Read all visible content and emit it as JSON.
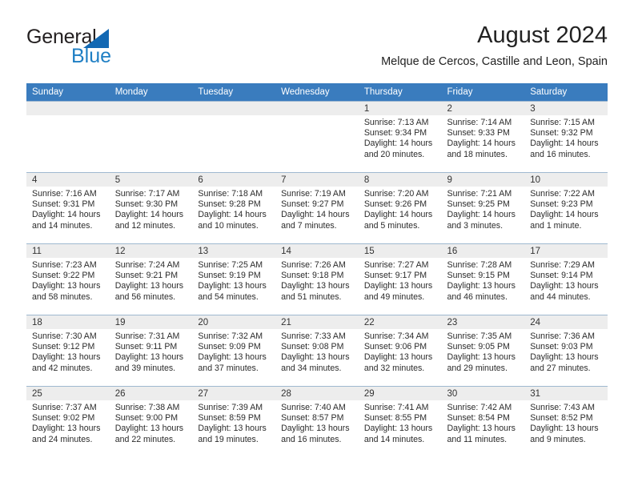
{
  "brand": {
    "word_one": "General",
    "word_two": "Blue",
    "triangle_icon": "triangle-logo-icon",
    "blue": "#1f7fc4"
  },
  "header": {
    "title": "August 2024",
    "subtitle": "Melque de Cercos, Castille and Leon, Spain"
  },
  "calendar": {
    "header_bg": "#3a7cbe",
    "daynum_bg": "#ededed",
    "weekdays": [
      "Sunday",
      "Monday",
      "Tuesday",
      "Wednesday",
      "Thursday",
      "Friday",
      "Saturday"
    ],
    "weeks": [
      [
        {
          "day": "",
          "lines": []
        },
        {
          "day": "",
          "lines": []
        },
        {
          "day": "",
          "lines": []
        },
        {
          "day": "",
          "lines": []
        },
        {
          "day": "1",
          "lines": [
            "Sunrise: 7:13 AM",
            "Sunset: 9:34 PM",
            "Daylight: 14 hours",
            "and 20 minutes."
          ]
        },
        {
          "day": "2",
          "lines": [
            "Sunrise: 7:14 AM",
            "Sunset: 9:33 PM",
            "Daylight: 14 hours",
            "and 18 minutes."
          ]
        },
        {
          "day": "3",
          "lines": [
            "Sunrise: 7:15 AM",
            "Sunset: 9:32 PM",
            "Daylight: 14 hours",
            "and 16 minutes."
          ]
        }
      ],
      [
        {
          "day": "4",
          "lines": [
            "Sunrise: 7:16 AM",
            "Sunset: 9:31 PM",
            "Daylight: 14 hours",
            "and 14 minutes."
          ]
        },
        {
          "day": "5",
          "lines": [
            "Sunrise: 7:17 AM",
            "Sunset: 9:30 PM",
            "Daylight: 14 hours",
            "and 12 minutes."
          ]
        },
        {
          "day": "6",
          "lines": [
            "Sunrise: 7:18 AM",
            "Sunset: 9:28 PM",
            "Daylight: 14 hours",
            "and 10 minutes."
          ]
        },
        {
          "day": "7",
          "lines": [
            "Sunrise: 7:19 AM",
            "Sunset: 9:27 PM",
            "Daylight: 14 hours",
            "and 7 minutes."
          ]
        },
        {
          "day": "8",
          "lines": [
            "Sunrise: 7:20 AM",
            "Sunset: 9:26 PM",
            "Daylight: 14 hours",
            "and 5 minutes."
          ]
        },
        {
          "day": "9",
          "lines": [
            "Sunrise: 7:21 AM",
            "Sunset: 9:25 PM",
            "Daylight: 14 hours",
            "and 3 minutes."
          ]
        },
        {
          "day": "10",
          "lines": [
            "Sunrise: 7:22 AM",
            "Sunset: 9:23 PM",
            "Daylight: 14 hours",
            "and 1 minute."
          ]
        }
      ],
      [
        {
          "day": "11",
          "lines": [
            "Sunrise: 7:23 AM",
            "Sunset: 9:22 PM",
            "Daylight: 13 hours",
            "and 58 minutes."
          ]
        },
        {
          "day": "12",
          "lines": [
            "Sunrise: 7:24 AM",
            "Sunset: 9:21 PM",
            "Daylight: 13 hours",
            "and 56 minutes."
          ]
        },
        {
          "day": "13",
          "lines": [
            "Sunrise: 7:25 AM",
            "Sunset: 9:19 PM",
            "Daylight: 13 hours",
            "and 54 minutes."
          ]
        },
        {
          "day": "14",
          "lines": [
            "Sunrise: 7:26 AM",
            "Sunset: 9:18 PM",
            "Daylight: 13 hours",
            "and 51 minutes."
          ]
        },
        {
          "day": "15",
          "lines": [
            "Sunrise: 7:27 AM",
            "Sunset: 9:17 PM",
            "Daylight: 13 hours",
            "and 49 minutes."
          ]
        },
        {
          "day": "16",
          "lines": [
            "Sunrise: 7:28 AM",
            "Sunset: 9:15 PM",
            "Daylight: 13 hours",
            "and 46 minutes."
          ]
        },
        {
          "day": "17",
          "lines": [
            "Sunrise: 7:29 AM",
            "Sunset: 9:14 PM",
            "Daylight: 13 hours",
            "and 44 minutes."
          ]
        }
      ],
      [
        {
          "day": "18",
          "lines": [
            "Sunrise: 7:30 AM",
            "Sunset: 9:12 PM",
            "Daylight: 13 hours",
            "and 42 minutes."
          ]
        },
        {
          "day": "19",
          "lines": [
            "Sunrise: 7:31 AM",
            "Sunset: 9:11 PM",
            "Daylight: 13 hours",
            "and 39 minutes."
          ]
        },
        {
          "day": "20",
          "lines": [
            "Sunrise: 7:32 AM",
            "Sunset: 9:09 PM",
            "Daylight: 13 hours",
            "and 37 minutes."
          ]
        },
        {
          "day": "21",
          "lines": [
            "Sunrise: 7:33 AM",
            "Sunset: 9:08 PM",
            "Daylight: 13 hours",
            "and 34 minutes."
          ]
        },
        {
          "day": "22",
          "lines": [
            "Sunrise: 7:34 AM",
            "Sunset: 9:06 PM",
            "Daylight: 13 hours",
            "and 32 minutes."
          ]
        },
        {
          "day": "23",
          "lines": [
            "Sunrise: 7:35 AM",
            "Sunset: 9:05 PM",
            "Daylight: 13 hours",
            "and 29 minutes."
          ]
        },
        {
          "day": "24",
          "lines": [
            "Sunrise: 7:36 AM",
            "Sunset: 9:03 PM",
            "Daylight: 13 hours",
            "and 27 minutes."
          ]
        }
      ],
      [
        {
          "day": "25",
          "lines": [
            "Sunrise: 7:37 AM",
            "Sunset: 9:02 PM",
            "Daylight: 13 hours",
            "and 24 minutes."
          ]
        },
        {
          "day": "26",
          "lines": [
            "Sunrise: 7:38 AM",
            "Sunset: 9:00 PM",
            "Daylight: 13 hours",
            "and 22 minutes."
          ]
        },
        {
          "day": "27",
          "lines": [
            "Sunrise: 7:39 AM",
            "Sunset: 8:59 PM",
            "Daylight: 13 hours",
            "and 19 minutes."
          ]
        },
        {
          "day": "28",
          "lines": [
            "Sunrise: 7:40 AM",
            "Sunset: 8:57 PM",
            "Daylight: 13 hours",
            "and 16 minutes."
          ]
        },
        {
          "day": "29",
          "lines": [
            "Sunrise: 7:41 AM",
            "Sunset: 8:55 PM",
            "Daylight: 13 hours",
            "and 14 minutes."
          ]
        },
        {
          "day": "30",
          "lines": [
            "Sunrise: 7:42 AM",
            "Sunset: 8:54 PM",
            "Daylight: 13 hours",
            "and 11 minutes."
          ]
        },
        {
          "day": "31",
          "lines": [
            "Sunrise: 7:43 AM",
            "Sunset: 8:52 PM",
            "Daylight: 13 hours",
            "and 9 minutes."
          ]
        }
      ]
    ]
  }
}
